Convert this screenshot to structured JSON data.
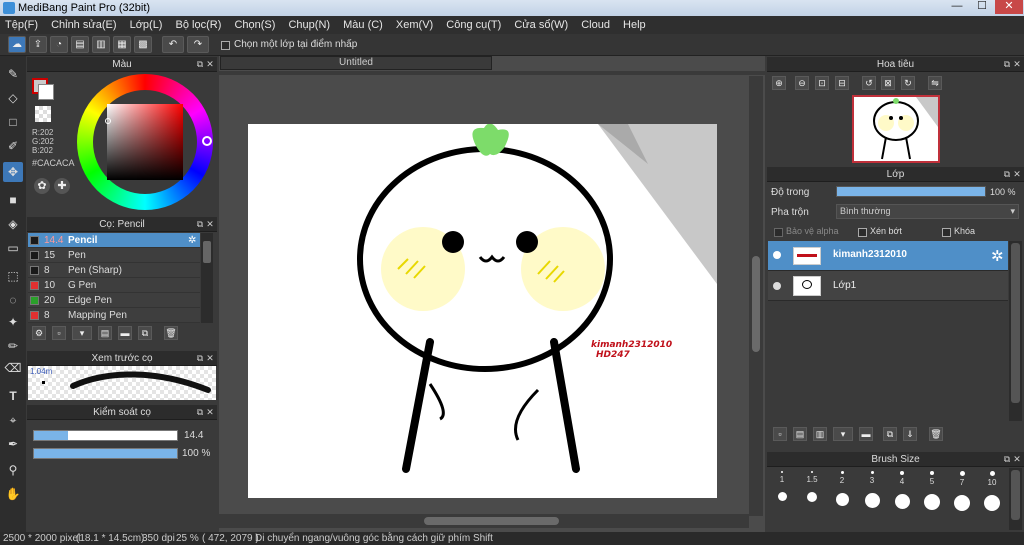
{
  "window": {
    "title": "MediBang Paint Pro (32bit)",
    "minimize": "—",
    "maximize": "☐",
    "close": "✕"
  },
  "menu": [
    "Tệp(F)",
    "Chỉnh sửa(E)",
    "Lớp(L)",
    "Bộ lọc(R)",
    "Chọn(S)",
    "Chụp(N)",
    "Màu (C)",
    "Xem(V)",
    "Công cụ(T)",
    "Cửa sổ(W)",
    "Cloud",
    "Help"
  ],
  "toolbar": {
    "select_layer_label": "Chọn một lớp tại điểm nhấp"
  },
  "color_panel": {
    "title": "Màu",
    "r": "R:202",
    "g": "G:202",
    "b": "B:202",
    "hex": "#CACACA",
    "primary": "#CACACA",
    "secondary": "#ffffff"
  },
  "brush_panel": {
    "title": "Cọ: Pencil",
    "items": [
      {
        "size": "14.4",
        "name": "Pencil",
        "color": "#1a1a1a"
      },
      {
        "size": "15",
        "name": "Pen",
        "color": "#1a1a1a"
      },
      {
        "size": "8",
        "name": "Pen (Sharp)",
        "color": "#1a1a1a"
      },
      {
        "size": "10",
        "name": "G Pen",
        "color": "#e03030"
      },
      {
        "size": "20",
        "name": "Edge Pen",
        "color": "#2aa02a"
      },
      {
        "size": "8",
        "name": "Mapping Pen",
        "color": "#e03030"
      }
    ]
  },
  "preview_panel": {
    "title": "Xem trước cọ",
    "size_label": "1.04m"
  },
  "control_panel": {
    "title": "Kiểm soát cọ",
    "size_value": "14.4",
    "opacity_value": "100 %",
    "size_fraction": 0.24,
    "opacity_fraction": 1.0
  },
  "canvas": {
    "tab": "Untitled",
    "signature_line1": "kimanh2312010",
    "signature_line2": "HD247"
  },
  "navigator": {
    "title": "Hoa tiêu"
  },
  "layer_panel": {
    "title": "Lớp",
    "opacity_label": "Độ trong",
    "opacity_value": "100 %",
    "opacity_fraction": 1.0,
    "blend_label": "Pha trộn",
    "blend_value": "Bình thường",
    "protect_alpha": "Bảo vệ alpha",
    "clipping": "Xén bớt",
    "lock": "Khóa",
    "layers": [
      {
        "name": "kimanh2312010",
        "selected": true
      },
      {
        "name": "Lớp1",
        "selected": false
      }
    ]
  },
  "brush_size_panel": {
    "title": "Brush Size",
    "sizes": [
      "1",
      "1.5",
      "2",
      "3",
      "4",
      "5",
      "7",
      "10"
    ]
  },
  "status": {
    "dimensions": "2500 * 2000 pixel",
    "physical": "(18.1 * 14.5cm)",
    "dpi": "350 dpi",
    "zoom": "25 %",
    "coords": "( 472, 2079 )",
    "hint": "Di chuyển ngang/vuông góc bằng cách giữ phím Shift"
  }
}
